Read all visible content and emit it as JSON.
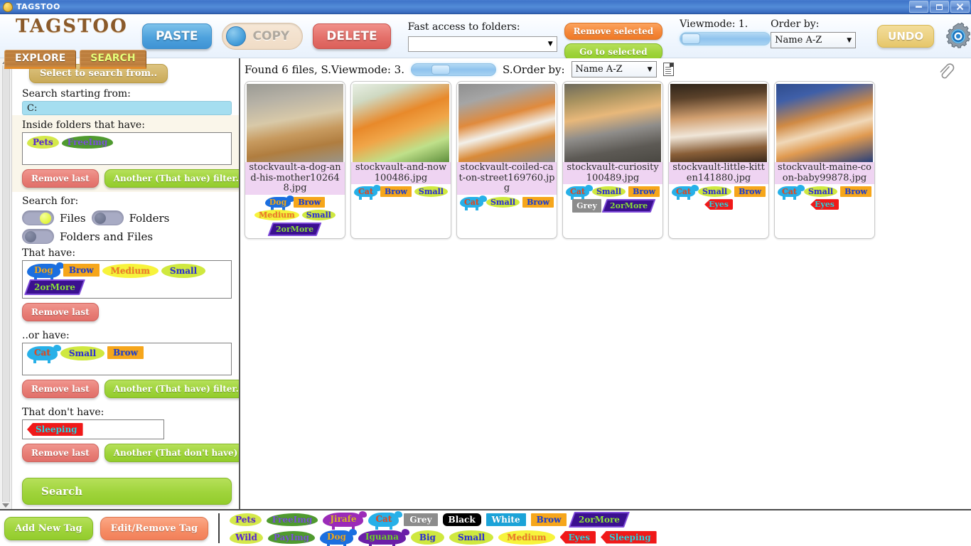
{
  "window": {
    "title": "TAGSTOO",
    "icon": "tagstoo-app-icon",
    "minimize": "–",
    "maximize": "❐",
    "close": "✕"
  },
  "brand": {
    "logo": "TAGSTOO",
    "tabs": [
      {
        "label": "EXPLORE",
        "active": false
      },
      {
        "label": "SEARCH",
        "active": true
      }
    ]
  },
  "toolbar": {
    "paste_label": "PASTE",
    "copy_label": "COPY",
    "delete_label": "DELETE",
    "fast_access_label": "Fast access to folders:",
    "fast_access_value": "",
    "remove_selected_label": "Remove selected",
    "go_to_selected_label": "Go to selected",
    "viewmode_label": "Viewmode: 1.",
    "viewmode_value": 1,
    "order_by_label": "Order by:",
    "order_by_value": "Name A-Z",
    "undo_label": "UNDO",
    "gear_icon": "gear-icon",
    "info_icon": "info-icon"
  },
  "sidebar": {
    "select_button": "Select to search from..",
    "start_label": "Search starting from:",
    "start_value": "C:",
    "inside_label": "Inside folders that have:",
    "inside_tags": [
      {
        "label": "Pets",
        "bg": "#d4e84a",
        "fg": "#5a27d6",
        "shape": "blob"
      },
      {
        "label": "FreeImg",
        "bg": "#4f9a2f",
        "fg": "#7a52d8",
        "shape": "blob"
      }
    ],
    "inside_remove_label": "Remove last",
    "inside_another_label": "Another (That have) filter..",
    "search_for_label": "Search for:",
    "options": [
      {
        "label": "Files",
        "on": true
      },
      {
        "label": "Folders",
        "on": false
      },
      {
        "label": "Folders and Files",
        "on": false
      }
    ],
    "that_have_label": "That have:",
    "that_have_tags": [
      {
        "label": "Dog",
        "bg": "#1b6fe0",
        "fg": "#f0a81e",
        "shape": "animal"
      },
      {
        "label": "Brow",
        "bg": "#f6a61b",
        "fg": "#1b3fd4",
        "shape": "rect"
      },
      {
        "label": "Medium",
        "bg": "#f7f33c",
        "fg": "#f07a2a",
        "shape": "ellipse"
      },
      {
        "label": "Small",
        "bg": "#cfe83f",
        "fg": "#2c2fd8",
        "shape": "ellipse"
      },
      {
        "label": "2orMore",
        "bg": "#3b1090",
        "fg": "#8ae03c",
        "shape": "para"
      }
    ],
    "that_have_remove_label": "Remove last",
    "or_have_label": "..or have:",
    "or_have_tags": [
      {
        "label": "Cat",
        "bg": "#27b0e8",
        "fg": "#e8491d",
        "shape": "animal"
      },
      {
        "label": "Small",
        "bg": "#cfe83f",
        "fg": "#2c2fd8",
        "shape": "ellipse"
      },
      {
        "label": "Brow",
        "bg": "#f6a61b",
        "fg": "#1b3fd4",
        "shape": "rect"
      }
    ],
    "or_have_remove_label": "Remove last",
    "or_have_another_label": "Another (That have) filter..",
    "or_have_trash_icon": "trash-icon",
    "dont_have_label": "That don't have:",
    "dont_have_tags": [
      {
        "label": "Sleeping",
        "bg": "#f01919",
        "fg": "#2bd4e0",
        "shape": "arrow"
      }
    ],
    "dont_have_remove_label": "Remove last",
    "dont_have_another_label": "Another (That don't have) filter..",
    "search_button": "Search"
  },
  "results": {
    "status": "Found 6 files, S.Viewmode: 3.",
    "s_viewmode_value": 3,
    "s_order_label": "S.Order by:",
    "s_order_value": "Name A-Z",
    "list_icon": "list-view-icon",
    "clip_icon": "paperclip-icon",
    "items": [
      {
        "filename": "stockvault-a-dog-and-his-mother102648.jpg",
        "thumb": "dog-and-mother-photo",
        "tags": [
          {
            "label": "Dog",
            "bg": "#1b6fe0",
            "fg": "#f0a81e",
            "shape": "animal"
          },
          {
            "label": "Brow",
            "bg": "#f6a61b",
            "fg": "#1b3fd4",
            "shape": "rect"
          },
          {
            "label": "Medium",
            "bg": "#f7f33c",
            "fg": "#f07a2a",
            "shape": "ellipse"
          },
          {
            "label": "Small",
            "bg": "#cfe83f",
            "fg": "#2c2fd8",
            "shape": "ellipse"
          },
          {
            "label": "2orMore",
            "bg": "#3b1090",
            "fg": "#8ae03c",
            "shape": "para"
          }
        ]
      },
      {
        "filename": "stockvault-and-now100486.jpg",
        "thumb": "orange-kitten-in-snow-photo",
        "tags": [
          {
            "label": "Cat",
            "bg": "#27b0e8",
            "fg": "#e8491d",
            "shape": "animal"
          },
          {
            "label": "Brow",
            "bg": "#f6a61b",
            "fg": "#1b3fd4",
            "shape": "rect"
          },
          {
            "label": "Small",
            "bg": "#cfe83f",
            "fg": "#2c2fd8",
            "shape": "ellipse"
          }
        ]
      },
      {
        "filename": "stockvault-coiled-cat-on-street169760.jpg",
        "thumb": "coiled-cat-on-street-photo",
        "tags": [
          {
            "label": "Cat",
            "bg": "#27b0e8",
            "fg": "#e8491d",
            "shape": "animal"
          },
          {
            "label": "Small",
            "bg": "#cfe83f",
            "fg": "#2c2fd8",
            "shape": "ellipse"
          },
          {
            "label": "Brow",
            "bg": "#f6a61b",
            "fg": "#1b3fd4",
            "shape": "rect"
          }
        ]
      },
      {
        "filename": "stockvault-curiosity100489.jpg",
        "thumb": "two-kittens-on-wall-photo",
        "tags": [
          {
            "label": "Cat",
            "bg": "#27b0e8",
            "fg": "#e8491d",
            "shape": "animal"
          },
          {
            "label": "Small",
            "bg": "#cfe83f",
            "fg": "#2c2fd8",
            "shape": "ellipse"
          },
          {
            "label": "Brow",
            "bg": "#f6a61b",
            "fg": "#1b3fd4",
            "shape": "rect"
          },
          {
            "label": "Grey",
            "bg": "#8c8c8c",
            "fg": "#ffffff",
            "shape": "rect"
          },
          {
            "label": "2orMore",
            "bg": "#3b1090",
            "fg": "#8ae03c",
            "shape": "para"
          }
        ]
      },
      {
        "filename": "stockvault-little-kitten141880.jpg",
        "thumb": "little-kitten-portrait-photo",
        "tags": [
          {
            "label": "Cat",
            "bg": "#27b0e8",
            "fg": "#e8491d",
            "shape": "animal"
          },
          {
            "label": "Small",
            "bg": "#cfe83f",
            "fg": "#2c2fd8",
            "shape": "ellipse"
          },
          {
            "label": "Brow",
            "bg": "#f6a61b",
            "fg": "#1b3fd4",
            "shape": "rect"
          },
          {
            "label": "Eyes",
            "bg": "#f01919",
            "fg": "#2bd4e0",
            "shape": "arrow"
          }
        ]
      },
      {
        "filename": "stockvault-maine-coon-baby99878.jpg",
        "thumb": "maine-coon-baby-photo",
        "tags": [
          {
            "label": "Cat",
            "bg": "#27b0e8",
            "fg": "#e8491d",
            "shape": "animal"
          },
          {
            "label": "Small",
            "bg": "#cfe83f",
            "fg": "#2c2fd8",
            "shape": "ellipse"
          },
          {
            "label": "Brow",
            "bg": "#f6a61b",
            "fg": "#1b3fd4",
            "shape": "rect"
          },
          {
            "label": "Eyes",
            "bg": "#f01919",
            "fg": "#2bd4e0",
            "shape": "arrow"
          }
        ]
      }
    ]
  },
  "bottom": {
    "add_tag_label": "Add New Tag",
    "edit_tag_label": "Edit/Remove Tag",
    "palette_row1": [
      {
        "label": "Pets",
        "bg": "#d4e84a",
        "fg": "#5a27d6",
        "shape": "blob"
      },
      {
        "label": "FreeImg",
        "bg": "#4f9a2f",
        "fg": "#7a52d8",
        "shape": "blob"
      },
      {
        "label": "Jirafe",
        "bg": "#9b2bb8",
        "fg": "#d8b62a",
        "shape": "animal"
      },
      {
        "label": "Cat",
        "bg": "#27b0e8",
        "fg": "#e8491d",
        "shape": "animal"
      },
      {
        "label": "Grey",
        "bg": "#8c8c8c",
        "fg": "#ffffff",
        "shape": "rect"
      },
      {
        "label": "Black",
        "bg": "#000000",
        "fg": "#ffffff",
        "shape": "round"
      },
      {
        "label": "White",
        "bg": "#1ba3d8",
        "fg": "#ffffff",
        "shape": "rect"
      },
      {
        "label": "Brow",
        "bg": "#f6a61b",
        "fg": "#1b3fd4",
        "shape": "rect"
      },
      {
        "label": "2orMore",
        "bg": "#3b1090",
        "fg": "#8ae03c",
        "shape": "para"
      }
    ],
    "palette_row2": [
      {
        "label": "Wild",
        "bg": "#d4e84a",
        "fg": "#5a27d6",
        "shape": "blob"
      },
      {
        "label": "PayImg",
        "bg": "#4f9a2f",
        "fg": "#7a52d8",
        "shape": "blob"
      },
      {
        "label": "Dog",
        "bg": "#1b6fe0",
        "fg": "#f0a81e",
        "shape": "animal"
      },
      {
        "label": "Iguana",
        "bg": "#6b1fa8",
        "fg": "#6fd42a",
        "shape": "animal"
      },
      {
        "label": "Big",
        "bg": "#cfe83f",
        "fg": "#2c2fd8",
        "shape": "ellipse"
      },
      {
        "label": "Small",
        "bg": "#cfe83f",
        "fg": "#2c2fd8",
        "shape": "ellipse"
      },
      {
        "label": "Medium",
        "bg": "#f7f33c",
        "fg": "#f07a2a",
        "shape": "ellipse"
      },
      {
        "label": "Eyes",
        "bg": "#f01919",
        "fg": "#2bd4e0",
        "shape": "arrow"
      },
      {
        "label": "Sleeping",
        "bg": "#f01919",
        "fg": "#2bd4e0",
        "shape": "arrow"
      }
    ]
  }
}
